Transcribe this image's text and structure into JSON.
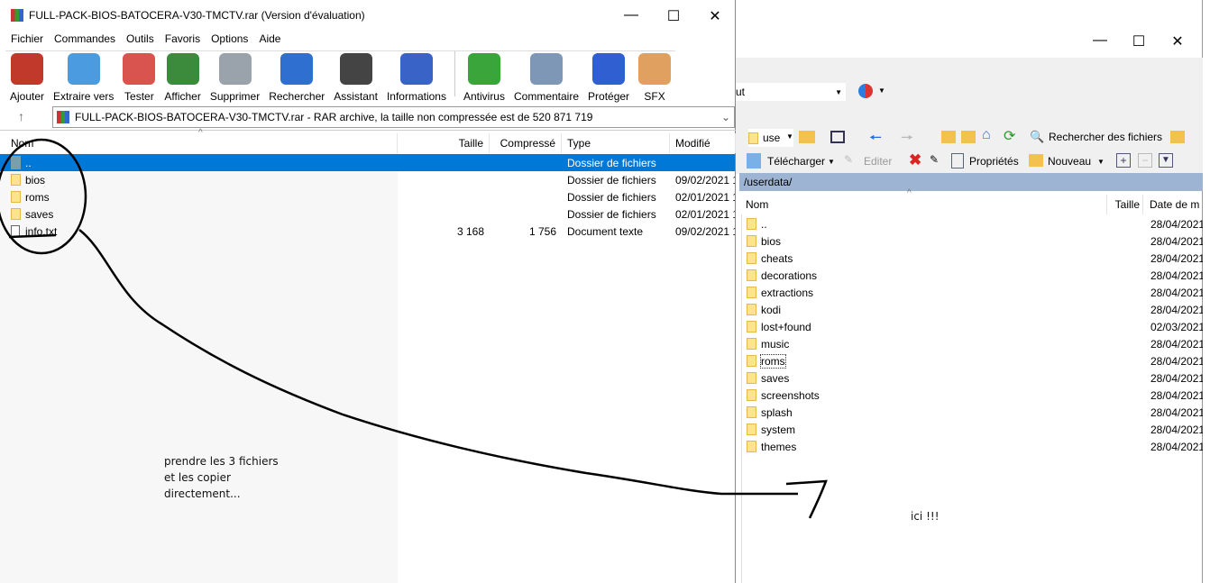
{
  "winrar": {
    "title": "FULL-PACK-BIOS-BATOCERA-V30-TMCTV.rar (Version d'évaluation)",
    "menu": [
      "Fichier",
      "Commandes",
      "Outils",
      "Favoris",
      "Options",
      "Aide"
    ],
    "toolbar": [
      {
        "label": "Ajouter",
        "icon": "add-archive-icon",
        "color": "#c0392b"
      },
      {
        "label": "Extraire vers",
        "icon": "extract-folder-icon",
        "color": "#4a9be0"
      },
      {
        "label": "Tester",
        "icon": "test-clipboard-icon",
        "color": "#d9534f"
      },
      {
        "label": "Afficher",
        "icon": "view-book-icon",
        "color": "#3c8a3c"
      },
      {
        "label": "Supprimer",
        "icon": "trash-icon",
        "color": "#9aa3ab"
      },
      {
        "label": "Rechercher",
        "icon": "search-magnifier-icon",
        "color": "#2f6fd0"
      },
      {
        "label": "Assistant",
        "icon": "wizard-wand-icon",
        "color": "#444"
      },
      {
        "label": "Informations",
        "icon": "info-icon",
        "color": "#3a63c8"
      },
      {
        "label": "Antivirus",
        "icon": "antivirus-bug-icon",
        "color": "#3aa53a"
      },
      {
        "label": "Commentaire",
        "icon": "comment-icon",
        "color": "#7f97b6"
      },
      {
        "label": "Protéger",
        "icon": "shield-icon",
        "color": "#2f5fd0"
      },
      {
        "label": "SFX",
        "icon": "sfx-box-icon",
        "color": "#e0a060"
      }
    ],
    "address": "FULL-PACK-BIOS-BATOCERA-V30-TMCTV.rar - RAR archive, la taille non compressée est de 520 871 719",
    "columns": [
      "Nom",
      "Taille",
      "Compressé",
      "Type",
      "Modifié"
    ],
    "rows": [
      {
        "name": "..",
        "size": "",
        "packed": "",
        "type": "Dossier de fichiers",
        "modified": ""
      },
      {
        "name": "bios",
        "size": "",
        "packed": "",
        "type": "Dossier de fichiers",
        "modified": "09/02/2021 1"
      },
      {
        "name": "roms",
        "size": "",
        "packed": "",
        "type": "Dossier de fichiers",
        "modified": "02/01/2021 1"
      },
      {
        "name": "saves",
        "size": "",
        "packed": "",
        "type": "Dossier de fichiers",
        "modified": "02/01/2021 1"
      },
      {
        "name": "info.txt",
        "size": "3 168",
        "packed": "1 756",
        "type": "Document texte",
        "modified": "09/02/2021 1"
      }
    ]
  },
  "winscp": {
    "combo_value": "ut",
    "drive_value": "use",
    "search_label": "Rechercher des fichiers",
    "download_label": "Télécharger",
    "edit_label": "Editer",
    "properties_label": "Propriétés",
    "new_label": "Nouveau",
    "path": "/userdata/",
    "columns": [
      "Nom",
      "Taille",
      "Date de m"
    ],
    "rows": [
      {
        "name": "..",
        "date": "28/04/2021"
      },
      {
        "name": "bios",
        "date": "28/04/2021"
      },
      {
        "name": "cheats",
        "date": "28/04/2021"
      },
      {
        "name": "decorations",
        "date": "28/04/2021"
      },
      {
        "name": "extractions",
        "date": "28/04/2021"
      },
      {
        "name": "kodi",
        "date": "28/04/2021"
      },
      {
        "name": "lost+found",
        "date": "02/03/2021"
      },
      {
        "name": "music",
        "date": "28/04/2021"
      },
      {
        "name": "roms",
        "date": "28/04/2021"
      },
      {
        "name": "saves",
        "date": "28/04/2021"
      },
      {
        "name": "screenshots",
        "date": "28/04/2021"
      },
      {
        "name": "splash",
        "date": "28/04/2021"
      },
      {
        "name": "system",
        "date": "28/04/2021"
      },
      {
        "name": "themes",
        "date": "28/04/2021"
      }
    ]
  },
  "annotations": {
    "line1": "prendre les 3 fichiers",
    "line2": "et les copier",
    "line3": "directement...",
    "target": "ici !!!"
  },
  "selection_color": "#0078d7"
}
